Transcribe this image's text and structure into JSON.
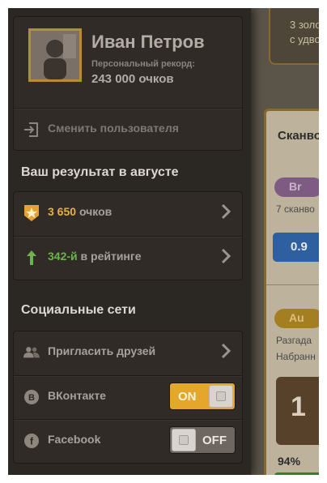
{
  "profile": {
    "name": "Иван Петров",
    "record_label": "Персональный рекорд:",
    "record_value": "243 000 очков"
  },
  "switch_user": {
    "label": "Сменить пользователя"
  },
  "august": {
    "title": "Ваш результат в августе",
    "points_value": "3 650",
    "points_unit": "очков",
    "rank_value": "342-й",
    "rank_text": "в рейтинге"
  },
  "social": {
    "title": "Социальные сети",
    "invite_label": "Пригласить друзей",
    "vk_label": "ВКонтакте",
    "vk_state": "ON",
    "fb_label": "Facebook",
    "fb_state": "OFF"
  },
  "background": {
    "notice_text": [
      "3 золо",
      "с удво"
    ],
    "card_title": "Сканво",
    "badge_br": "Br",
    "row_text": "7 сканво",
    "blue_value": "0.9",
    "badge_au": "Au",
    "text_1": "Разгада",
    "text_2": "Набранн",
    "tile_number": "1",
    "percent": "94%"
  },
  "colors": {
    "accent": "#e4a62b",
    "green": "#6db24e",
    "panel": "#302b27",
    "frame": "#b58e31"
  }
}
